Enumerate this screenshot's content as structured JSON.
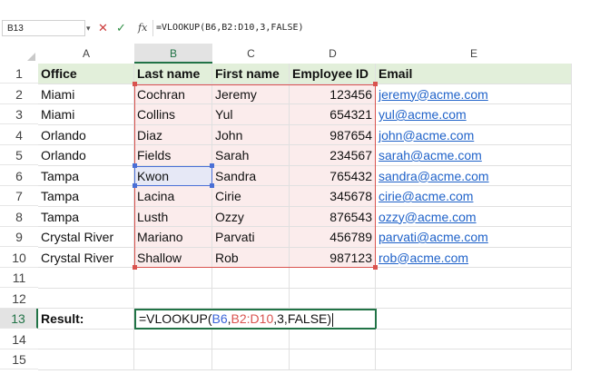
{
  "formula_bar": {
    "name_box": "B13",
    "fx_label": "fx",
    "formula": "=VLOOKUP(B6,B2:D10,3,FALSE)"
  },
  "columns": [
    "A",
    "B",
    "C",
    "D",
    "E"
  ],
  "selected_column": "B",
  "headers": {
    "office": "Office",
    "last_name": "Last name",
    "first_name": "First name",
    "employee_id": "Employee ID",
    "email": "Email"
  },
  "rows": [
    {
      "num": "1"
    },
    {
      "num": "2",
      "office": "Miami",
      "last": "Cochran",
      "first": "Jeremy",
      "id": "123456",
      "email": "jeremy@acme.com"
    },
    {
      "num": "3",
      "office": "Miami",
      "last": "Collins",
      "first": "Yul",
      "id": "654321",
      "email": "yul@acme.com"
    },
    {
      "num": "4",
      "office": "Orlando",
      "last": "Diaz",
      "first": "John",
      "id": "987654",
      "email": "john@acme.com"
    },
    {
      "num": "5",
      "office": "Orlando",
      "last": "Fields",
      "first": "Sarah",
      "id": "234567",
      "email": "sarah@acme.com"
    },
    {
      "num": "6",
      "office": "Tampa",
      "last": "Kwon",
      "first": "Sandra",
      "id": "765432",
      "email": "sandra@acme.com"
    },
    {
      "num": "7",
      "office": "Tampa",
      "last": "Lacina",
      "first": "Cirie",
      "id": "345678",
      "email": "cirie@acme.com"
    },
    {
      "num": "8",
      "office": "Tampa",
      "last": "Lusth",
      "first": "Ozzy",
      "id": "876543",
      "email": "ozzy@acme.com"
    },
    {
      "num": "9",
      "office": "Crystal River",
      "last": "Mariano",
      "first": "Parvati",
      "id": "456789",
      "email": "parvati@acme.com"
    },
    {
      "num": "10",
      "office": "Crystal River",
      "last": "Shallow",
      "first": "Rob",
      "id": "987123",
      "email": "rob@acme.com"
    },
    {
      "num": "11"
    },
    {
      "num": "12"
    },
    {
      "num": "13"
    },
    {
      "num": "14"
    },
    {
      "num": "15"
    }
  ],
  "result": {
    "label": "Result:",
    "formula_parts": {
      "prefix": "=VLOOKUP(",
      "ref1": "B6",
      "comma1": ",",
      "ref2": "B2:D10",
      "suffix": ",3,FALSE)"
    }
  },
  "colors": {
    "header_fill": "#e2efda",
    "range_fill": "#fbecec",
    "range_border": "#d9534f",
    "b6_border": "#4a6fd6",
    "active_border": "#217346",
    "link": "#1f62c9"
  }
}
